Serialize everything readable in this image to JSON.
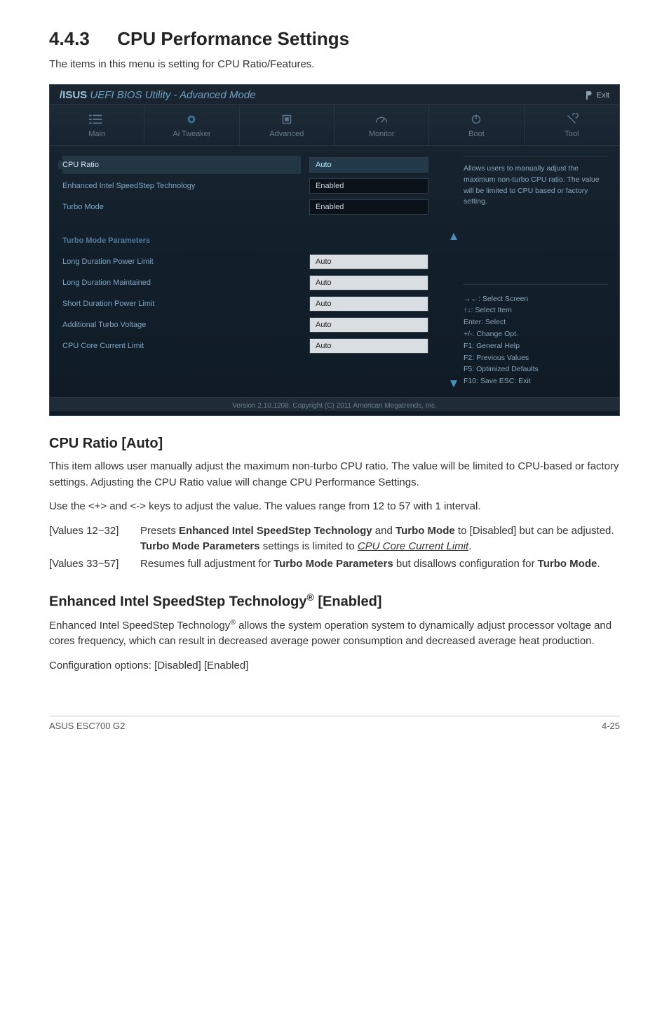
{
  "heading_number": "4.4.3",
  "heading_title": "CPU Performance Settings",
  "intro": "The items in this menu is setting for CPU Ratio/Features.",
  "bios": {
    "window_brand": "/ISUS",
    "window_title": "UEFI BIOS Utility - Advanced Mode",
    "exit_label": "Exit",
    "tabs": [
      "Main",
      "Ai  Tweaker",
      "Advanced",
      "Monitor",
      "Boot",
      "Tool"
    ],
    "rows": {
      "cpu_ratio": {
        "label": "CPU Ratio",
        "value": "Auto"
      },
      "eist": {
        "label": "Enhanced Intel SpeedStep Technology",
        "value": "Enabled"
      },
      "turbo_mode": {
        "label": "Turbo Mode",
        "value": "Enabled"
      },
      "turbo_params_header": "Turbo Mode Parameters",
      "long_power": {
        "label": "Long Duration Power Limit",
        "value": "Auto"
      },
      "long_maint": {
        "label": "Long Duration Maintained",
        "value": "Auto"
      },
      "short_power": {
        "label": "Short Duration Power Limit",
        "value": "Auto"
      },
      "add_voltage": {
        "label": "Additional Turbo Voltage",
        "value": "Auto"
      },
      "cpu_core_limit": {
        "label": "CPU Core Current Limit",
        "value": "Auto"
      }
    },
    "tip": "Allows users to manually adjust the maximum non-turbo CPU ratio. The value will be limited to CPU based or factory setting.",
    "help": [
      "→←: Select Screen",
      "↑↓: Select Item",
      "Enter: Select",
      "+/-: Change Opt.",
      "F1: General Help",
      "F2: Previous Values",
      "F5: Optimized Defaults",
      "F10: Save   ESC: Exit"
    ],
    "footer": "Version 2.10.1208.   Copyright (C) 2011 American Megatrends, Inc."
  },
  "sub1_title": "CPU Ratio [Auto]",
  "sub1_p1": "This item allows user manually adjust the maximum non-turbo CPU ratio. The value will be limited to CPU-based or factory settings. Adjusting the CPU Ratio value will change CPU Performance Settings.",
  "sub1_p2": "Use the <+> and <-> keys to adjust the value. The values range from 12 to 57 with 1 interval.",
  "values": {
    "v12_32_label": "[Values 12~32]",
    "v12_32_desc_a": "Presets ",
    "v12_32_desc_b": "Enhanced Intel SpeedStep Technology",
    "v12_32_desc_c": " and ",
    "v12_32_desc_d": "Turbo Mode",
    "v12_32_desc_e": " to [Disabled] but can be adjusted. ",
    "v12_32_desc_f": "Turbo Mode Parameters",
    "v12_32_desc_g": " settings is limited to ",
    "v12_32_desc_h": "CPU Core Current Limit",
    "v12_32_desc_i": ".",
    "v33_57_label": "[Values 33~57]",
    "v33_57_desc_a": "Resumes full adjustment for ",
    "v33_57_desc_b": "Turbo Mode Parameters",
    "v33_57_desc_c": " but disallows configuration for ",
    "v33_57_desc_d": "Turbo Mode",
    "v33_57_desc_e": "."
  },
  "sub2_title_a": "Enhanced Intel SpeedStep Technology",
  "sub2_title_b": " [Enabled]",
  "sub2_p1_a": "Enhanced Intel SpeedStep Technology",
  "sub2_p1_b": " allows the system operation system to dynamically adjust processor voltage and cores frequency, which can result in decreased average power consumption and decreased average heat production.",
  "sub2_p2": "Configuration options: [Disabled] [Enabled]",
  "footer_left": "ASUS ESC700 G2",
  "footer_right": "4-25"
}
